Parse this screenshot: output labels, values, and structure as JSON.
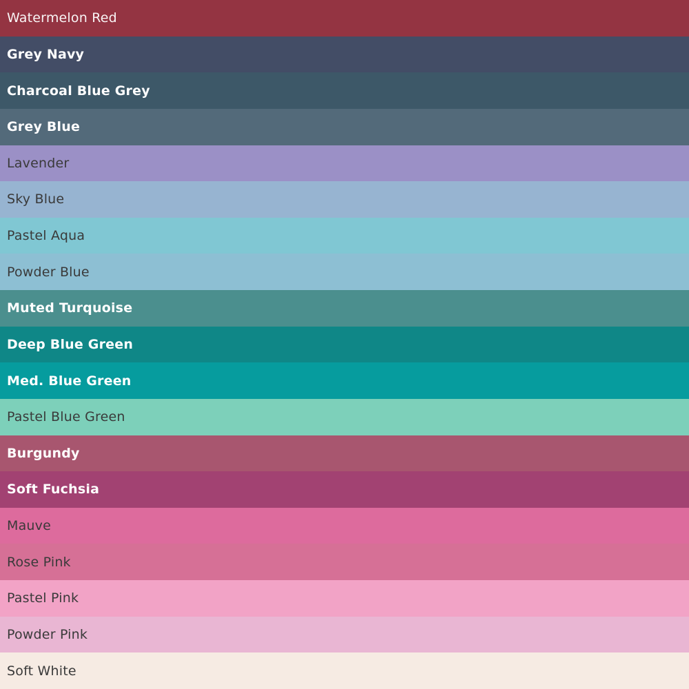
{
  "swatches": [
    {
      "name": "Watermelon Red",
      "color": "#943442",
      "text_color": "light"
    },
    {
      "name": "Grey Navy",
      "color": "#434d66",
      "text_color": "light"
    },
    {
      "name": "Charcoal Blue Grey",
      "color": "#3d5868",
      "text_color": "light"
    },
    {
      "name": "Grey Blue",
      "color": "#536a7a",
      "text_color": "light"
    },
    {
      "name": "Lavender",
      "color": "#9b90c6",
      "text_color": "dark"
    },
    {
      "name": "Sky Blue",
      "color": "#97b4d1",
      "text_color": "dark"
    },
    {
      "name": "Pastel Aqua",
      "color": "#80c7d3",
      "text_color": "dark"
    },
    {
      "name": "Powder Blue",
      "color": "#8dbfd3",
      "text_color": "dark"
    },
    {
      "name": "Muted Turquoise",
      "color": "#4b8f8e",
      "text_color": "light"
    },
    {
      "name": "Deep Blue Green",
      "color": "#0f8787",
      "text_color": "light"
    },
    {
      "name": "Med. Blue Green",
      "color": "#069c9e",
      "text_color": "light"
    },
    {
      "name": "Pastel Blue Green",
      "color": "#7dd0ba",
      "text_color": "dark"
    },
    {
      "name": "Burgundy",
      "color": "#a8566f",
      "text_color": "light"
    },
    {
      "name": "Soft Fuchsia",
      "color": "#a24272",
      "text_color": "light"
    },
    {
      "name": "Mauve",
      "color": "#dd6b9d",
      "text_color": "dark"
    },
    {
      "name": "Rose Pink",
      "color": "#d67096",
      "text_color": "dark"
    },
    {
      "name": "Pastel Pink",
      "color": "#f2a3c6",
      "text_color": "dark"
    },
    {
      "name": "Powder Pink",
      "color": "#e9b6d3",
      "text_color": "dark"
    },
    {
      "name": "Soft White",
      "color": "#f6ebe3",
      "text_color": "dark"
    }
  ]
}
